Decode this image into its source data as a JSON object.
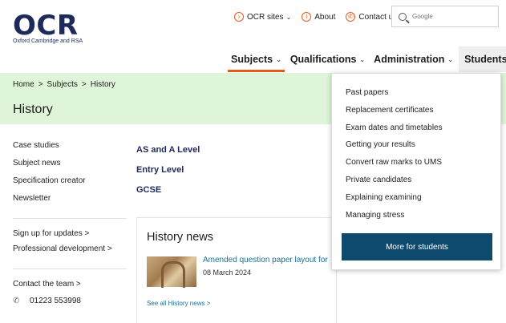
{
  "logo": {
    "text": "OCR",
    "subtitle": "Oxford Cambridge and RSA"
  },
  "utility": {
    "ocr_sites": "OCR sites",
    "about": "About",
    "contact": "Contact us"
  },
  "search": {
    "placeholder": "Google"
  },
  "nav": {
    "subjects": "Subjects",
    "qualifications": "Qualifications",
    "administration": "Administration",
    "students": "Students"
  },
  "breadcrumb": {
    "home": "Home",
    "sep1": ">",
    "subjects": "Subjects",
    "sep2": ">",
    "current": "History"
  },
  "page_title": "History",
  "left": {
    "links": [
      "Case studies",
      "Subject news",
      "Specification creator",
      "Newsletter"
    ],
    "signup": "Sign up for updates >",
    "profdev": "Professional development >",
    "contact_team": "Contact the team >",
    "phone": "01223 553998"
  },
  "quals": [
    "AS and A Level",
    "Entry Level",
    "GCSE"
  ],
  "news": {
    "title": "History news",
    "item_title": "Amended question paper layout for",
    "item_date": "08 March 2024",
    "see_all": "See all History news >"
  },
  "students_menu": {
    "items": [
      "Past papers",
      "Replacement certificates",
      "Exam dates and timetables",
      "Getting your results",
      "Convert raw marks to UMS",
      "Private candidates",
      "Explaining examining",
      "Managing stress"
    ],
    "button": "More for students"
  },
  "colors": {
    "accent": "#e35a1c",
    "navy": "#1e2a5a",
    "banner": "#def5d9",
    "button": "#0e4a6e",
    "link": "#1e6f93"
  }
}
